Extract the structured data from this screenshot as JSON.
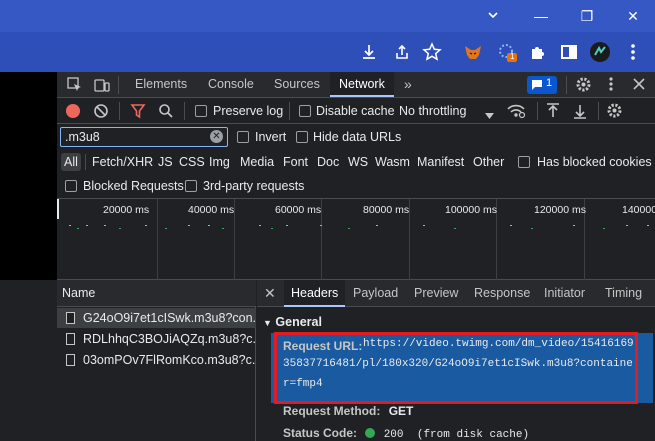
{
  "colors": {
    "accent": "#a8c7fa",
    "browser_blue": "#3658c4",
    "highlight_red": "#e31b23",
    "selected_row": "#1a5aa0"
  },
  "window": {
    "minimize": "—",
    "restore": "❐",
    "close": "✕"
  },
  "browser_toolbar": {
    "icons": [
      "download-icon",
      "share-icon",
      "bookmark-star-icon",
      "metamask-icon",
      "extension-badge-icon",
      "puzzle-icon",
      "sidepanel-icon",
      "profile-avatar",
      "more-vert-icon"
    ],
    "badge": "1"
  },
  "devtools": {
    "tabs": [
      "Elements",
      "Console",
      "Sources",
      "Network"
    ],
    "active_tab": "Network",
    "more_tabs": "»",
    "issues_count": "1"
  },
  "network_toolbar": {
    "preserve_log": "Preserve log",
    "disable_cache": "Disable cache",
    "throttling": "No throttling"
  },
  "filter": {
    "value": ".m3u8",
    "invert": "Invert",
    "hide_data_urls": "Hide data URLs"
  },
  "type_filters": [
    "All",
    "Fetch/XHR",
    "JS",
    "CSS",
    "Img",
    "Media",
    "Font",
    "Doc",
    "WS",
    "Wasm",
    "Manifest",
    "Other"
  ],
  "has_blocked_cookies": "Has blocked cookies",
  "blocked_requests": "Blocked Requests",
  "third_party": "3rd-party requests",
  "timeline": {
    "ticks": [
      "20000 ms",
      "40000 ms",
      "60000 ms",
      "80000 ms",
      "100000 ms",
      "120000 ms",
      "140000"
    ]
  },
  "requests": {
    "header": "Name",
    "items": [
      "G24oO9i7et1cISwk.m3u8?con...",
      "RDLhhqC3BOJiAQZq.m3u8?c...",
      "03omPOv7FlRomKco.m3u8?c..."
    ]
  },
  "detail": {
    "close": "✕",
    "tabs": [
      "Headers",
      "Payload",
      "Preview",
      "Response",
      "Initiator",
      "Timing"
    ],
    "active_tab": "Headers",
    "section": "General",
    "request_url_key": "Request URL:",
    "request_url_lines": [
      "https://video.twimg.com/dm_video/15416169",
      "35837716481/pl/180x320/G24oO9i7et1cISwk.m3u8?containe",
      "r=fmp4"
    ],
    "request_method_key": "Request Method:",
    "request_method_val": "GET",
    "status_code_key": "Status Code:",
    "status_code_val": "200",
    "status_note": "(from disk cache)"
  }
}
